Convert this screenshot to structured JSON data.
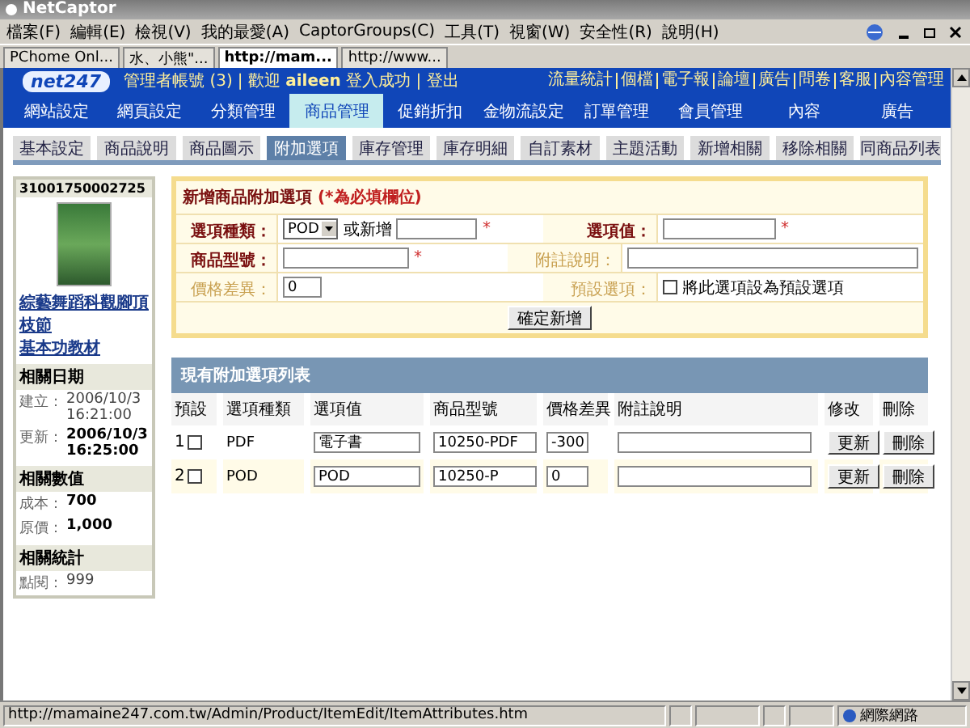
{
  "window": {
    "title": "NetCaptor"
  },
  "menu": [
    "檔案(F)",
    "編輯(E)",
    "檢視(V)",
    "我的最愛(A)",
    "CaptorGroups(C)",
    "工具(T)",
    "視窗(W)",
    "安全性(R)",
    "說明(H)"
  ],
  "browser_tabs": [
    {
      "label": "PChome Onl...",
      "selected": false
    },
    {
      "label": "水、小熊\"...",
      "selected": false
    },
    {
      "label": "http://mam...",
      "selected": true
    },
    {
      "label": "http://www...",
      "selected": false
    }
  ],
  "header": {
    "logo": "net247",
    "admin": "管理者帳號 (3)",
    "welcome": "| 歡迎 **aileen** 登入成功 | 登出",
    "links": [
      "流量統計",
      "個檔",
      "電子報",
      "論壇",
      "廣告",
      "問卷",
      "客服",
      "內容管理"
    ]
  },
  "nav": [
    {
      "label": "網站設定",
      "selected": false
    },
    {
      "label": "網頁設定",
      "selected": false
    },
    {
      "label": "分類管理",
      "selected": false
    },
    {
      "label": "商品管理",
      "selected": true
    },
    {
      "label": "促銷折扣",
      "selected": false
    },
    {
      "label": "金物流設定",
      "selected": false
    },
    {
      "label": "訂單管理",
      "selected": false
    },
    {
      "label": "會員管理",
      "selected": false
    },
    {
      "label": "內容",
      "selected": false
    },
    {
      "label": "廣告",
      "selected": false
    }
  ],
  "sub_tabs": [
    {
      "label": "基本設定",
      "selected": false
    },
    {
      "label": "商品說明",
      "selected": false
    },
    {
      "label": "商品圖示",
      "selected": false
    },
    {
      "label": "附加選項",
      "selected": true
    },
    {
      "label": "庫存管理",
      "selected": false
    },
    {
      "label": "庫存明細",
      "selected": false
    },
    {
      "label": "自訂素材",
      "selected": false
    },
    {
      "label": "主題活動",
      "selected": false
    },
    {
      "label": "新增相關",
      "selected": false
    },
    {
      "label": "移除相關",
      "selected": false
    },
    {
      "label": "同商品列表",
      "selected": false
    }
  ],
  "sidebar": {
    "item_id": "31001750002725",
    "title_link": "綜藝舞蹈科觀腳頂枝節",
    "subtitle_link": "基本功教材",
    "sections": [
      {
        "title": "相關日期",
        "rows": [
          {
            "label": "建立：",
            "value": "2006/10/3 16:21:00",
            "bold": false
          },
          {
            "label": "更新：",
            "value": "2006/10/3 16:25:00",
            "bold": true
          }
        ]
      },
      {
        "title": "相關數值",
        "rows": [
          {
            "label": "成本：",
            "value": "700",
            "bold": true
          },
          {
            "label": "原價：",
            "value": "1,000",
            "bold": true
          }
        ]
      },
      {
        "title": "相關統計",
        "rows": [
          {
            "label": "點閱：",
            "value": "999",
            "bold": false
          }
        ]
      }
    ]
  },
  "add_form": {
    "title": "新增商品附加選項",
    "note": "(*為必填欄位)",
    "type_label": "選項種類：",
    "type_select": "POD",
    "or_new": "或新增",
    "value_label": "選項值：",
    "model_label": "商品型號：",
    "remark_label": "附註說明：",
    "price_label": "價格差異：",
    "price_value": "0",
    "default_label": "預設選項：",
    "default_checkbox": {
      "label": "將此選項設為預設選項",
      "checked": false
    },
    "required_mark": "*",
    "submit": "確定新增"
  },
  "list": {
    "title": "現有附加選項列表",
    "columns": [
      "預設",
      "選項種類",
      "選項值",
      "商品型號",
      "價格差異",
      "附註說明",
      "修改",
      "刪除"
    ],
    "rows": [
      {
        "index": "1",
        "checked": false,
        "type": "PDF",
        "value": "電子書",
        "model": "10250-PDF",
        "price": "-300",
        "update": "更新",
        "delete": "刪除"
      },
      {
        "index": "2",
        "checked": false,
        "type": "POD",
        "value": "POD",
        "model": "10250-P",
        "price": "0",
        "update": "更新",
        "delete": "刪除"
      }
    ]
  },
  "status_bar": {
    "url": "http://mamaine247.com.tw/Admin/Product/ItemEdit/ItemAttributes.htm",
    "zone": "網際網路"
  }
}
